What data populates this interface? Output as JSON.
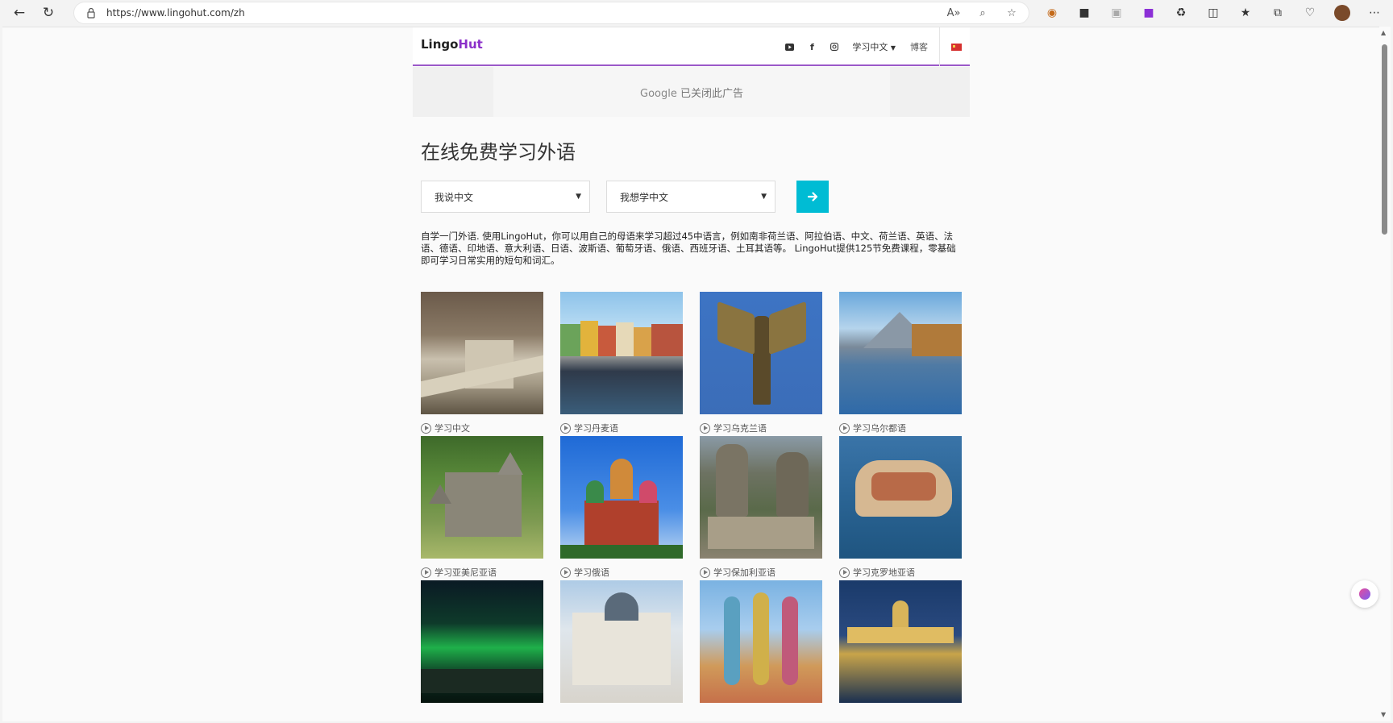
{
  "browser": {
    "url": "https://www.lingohut.com/zh",
    "read_aloud_label": "A»",
    "profile_initial": ""
  },
  "site": {
    "logo_main": "Lingo",
    "logo_accent": "Hut",
    "nav": {
      "youtube_icon": "youtube-icon",
      "facebook_icon": "facebook-icon",
      "instagram_icon": "instagram-icon",
      "learn_menu": "学习中文",
      "blog": "博客",
      "flag": "china-flag-icon"
    },
    "ad_text_brand": "Google",
    "ad_text_rest": " 已关闭此广告",
    "title": "在线免费学习外语",
    "selector_native": "我说中文",
    "selector_target": "我想学中文",
    "go_icon": "arrow-right-icon",
    "description": "自学一门外语. 使用LingoHut，你可以用自己的母语来学习超过45中语言，例如南非荷兰语、阿拉伯语、中文、荷兰语、英语、法语、德语、印地语、意大利语、日语、波斯语、葡萄牙语、俄语、西班牙语、土耳其语等。 LingoHut提供125节免费课程，零基础即可学习日常实用的短句和词汇。"
  },
  "courses": [
    {
      "label": "学习中文",
      "image": "great-wall-photo"
    },
    {
      "label": "学习丹麦语",
      "image": "nyhavn-photo"
    },
    {
      "label": "学习乌克兰语",
      "image": "archangel-statue-photo"
    },
    {
      "label": "学习乌尔都语",
      "image": "mountain-lake-photo"
    },
    {
      "label": "学习亚美尼亚语",
      "image": "armenian-monastery-photo"
    },
    {
      "label": "学习俄语",
      "image": "st-basils-cathedral-photo"
    },
    {
      "label": "学习保加利亚语",
      "image": "belogradchik-fortress-photo"
    },
    {
      "label": "学习克罗地亚语",
      "image": "dubrovnik-photo"
    },
    {
      "label": "",
      "image": "aurora-photo"
    },
    {
      "label": "",
      "image": "palace-photo"
    },
    {
      "label": "",
      "image": "gaudi-chimneys-photo"
    },
    {
      "label": "",
      "image": "budapest-parliament-photo"
    }
  ]
}
